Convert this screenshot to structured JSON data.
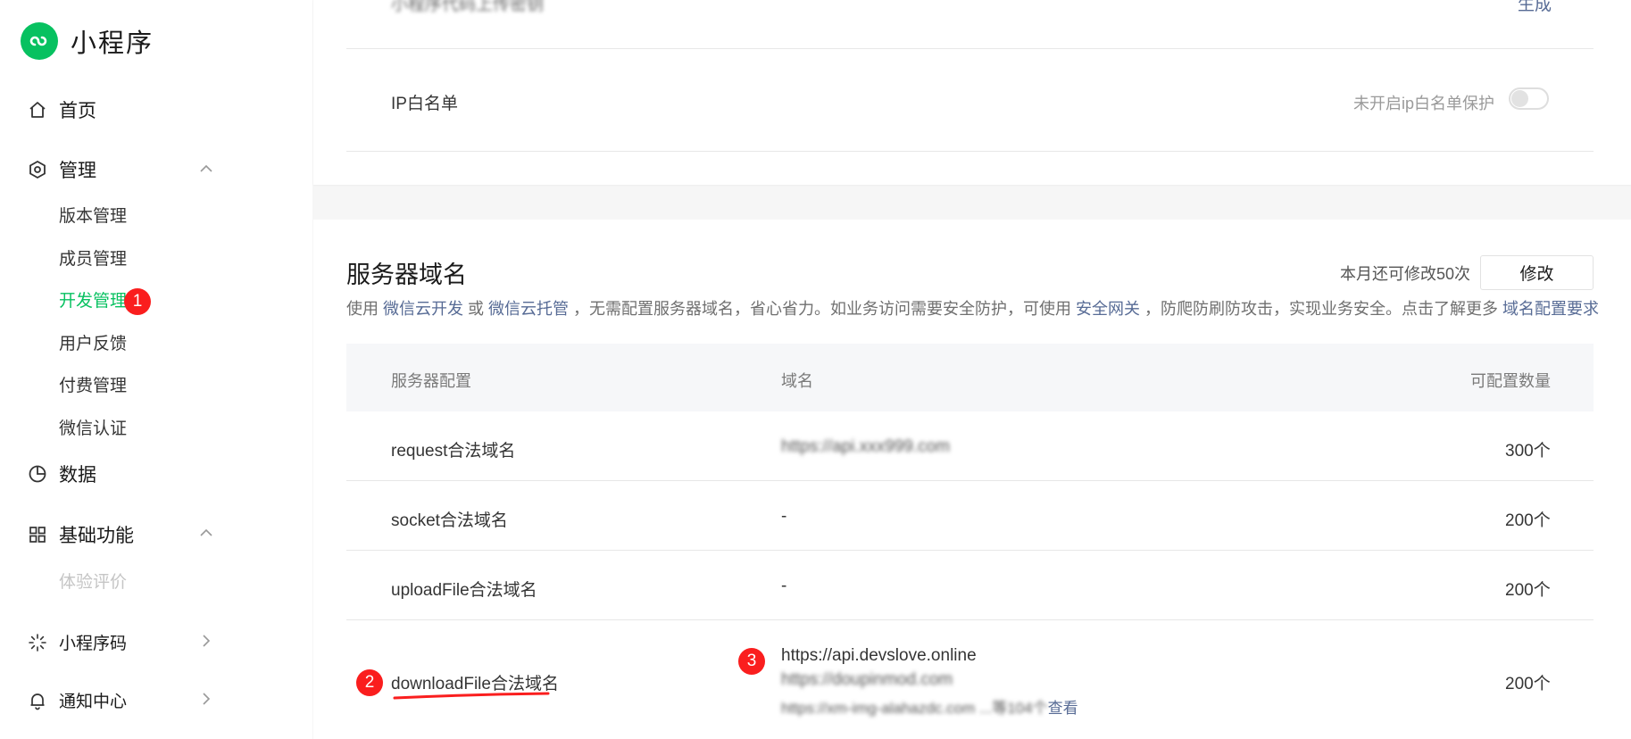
{
  "brand": {
    "title": "小程序"
  },
  "sidebar": {
    "home": "首页",
    "manage": "管理",
    "manage_items": [
      "版本管理",
      "成员管理",
      "开发管理",
      "用户反馈",
      "付费管理",
      "微信认证"
    ],
    "data": "数据",
    "basic": "基础功能",
    "basic_items": [
      "体验评价"
    ],
    "qrcode": "小程序码",
    "notify": "通知中心"
  },
  "markers": [
    "1",
    "2",
    "3"
  ],
  "top_card": {
    "cut_label": "小程序代码上传密钥",
    "cut_link": "生成",
    "ip_label": "IP白名单",
    "ip_status": "未开启ip白名单保护"
  },
  "server": {
    "title": "服务器域名",
    "quota": "本月还可修改50次",
    "modify_button": "修改",
    "desc": {
      "p1": "使用 ",
      "link1": "微信云开发",
      "p2": " 或 ",
      "link2": "微信云托管",
      "p3": " ，无需配置服务器域名，省心省力。如业务访问需要安全防护，可使用 ",
      "link3": "安全网关",
      "p4": " ，防爬防刷防攻击，实现业务安全。点击了解更多 ",
      "link4": "域名配置要求"
    },
    "columns": [
      "服务器配置",
      "域名",
      "可配置数量"
    ],
    "rows": [
      {
        "name": "request合法域名",
        "domain": "https://api.xxx999.com",
        "count": "300个"
      },
      {
        "name": "socket合法域名",
        "domain": "-",
        "count": "200个"
      },
      {
        "name": "uploadFile合法域名",
        "domain": "-",
        "count": "200个"
      },
      {
        "name": "downloadFile合法域名",
        "domains": [
          "https://api.devslove.online",
          "https://doupinmod.com",
          "https://xm-img-alahazdc.com"
        ],
        "more": "...等104个",
        "more_link": "查看",
        "count": "200个"
      }
    ]
  },
  "colors": {
    "brand_green": "#07c160",
    "link_blue": "#576b95",
    "marker_red": "#fa1e1e"
  }
}
